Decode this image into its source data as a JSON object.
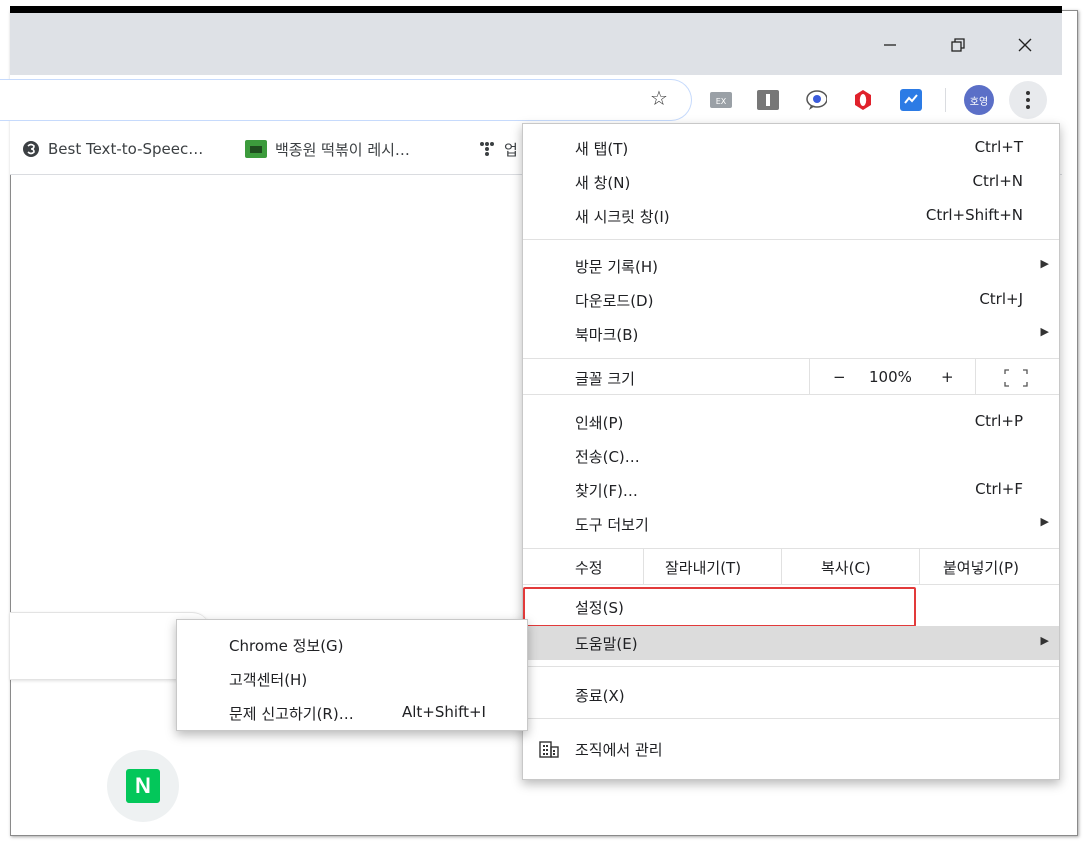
{
  "window": {
    "buttons": [
      "–",
      "❐",
      "✕"
    ]
  },
  "toolbar": {
    "star_icon": "star-icon",
    "extensions": [
      "ex-icon",
      "instapaper-icon",
      "reader-icon",
      "opera-icon",
      "check-icon"
    ],
    "profile_label": "호영",
    "colors": {
      "profile": "#5b6fc7",
      "opera": "#e0212b",
      "check": "#2c7be5"
    }
  },
  "bookmarks": {
    "items": [
      {
        "label": "Best Text-to-Speec…",
        "icon": "speech-icon"
      },
      {
        "label": "백종원 떡볶이 레시…",
        "icon": "folder-icon"
      },
      {
        "label": "업",
        "icon": "dots-icon"
      }
    ]
  },
  "menu": {
    "new_tab": {
      "label": "새 탭(T)",
      "shortcut": "Ctrl+T"
    },
    "new_window": {
      "label": "새 창(N)",
      "shortcut": "Ctrl+N"
    },
    "incognito": {
      "label": "새 시크릿 창(I)",
      "shortcut": "Ctrl+Shift+N"
    },
    "history": {
      "label": "방문 기록(H)"
    },
    "downloads": {
      "label": "다운로드(D)",
      "shortcut": "Ctrl+J"
    },
    "bookmarks": {
      "label": "북마크(B)"
    },
    "zoom": {
      "label": "글꼴 크기",
      "minus": "−",
      "value": "100%",
      "plus": "+"
    },
    "print": {
      "label": "인쇄(P)",
      "shortcut": "Ctrl+P"
    },
    "cast": {
      "label": "전송(C)…"
    },
    "find": {
      "label": "찾기(F)…",
      "shortcut": "Ctrl+F"
    },
    "more_tools": {
      "label": "도구 더보기"
    },
    "edit": {
      "label": "수정",
      "cut": "잘라내기(T)",
      "copy": "복사(C)",
      "paste": "붙여넣기(P)"
    },
    "settings": {
      "label": "설정(S)"
    },
    "help": {
      "label": "도움말(E)"
    },
    "exit": {
      "label": "종료(X)"
    },
    "managed": {
      "label": "조직에서 관리"
    }
  },
  "help_submenu": {
    "about": {
      "label": "Chrome 정보(G)"
    },
    "help_center": {
      "label": "고객센터(H)"
    },
    "report": {
      "label": "문제 신고하기(R)…",
      "shortcut": "Alt+Shift+I"
    }
  },
  "page": {
    "naver_letter": "N"
  },
  "colors": {
    "highlight_border": "#e23a3a",
    "naver_green": "#03c75a"
  }
}
